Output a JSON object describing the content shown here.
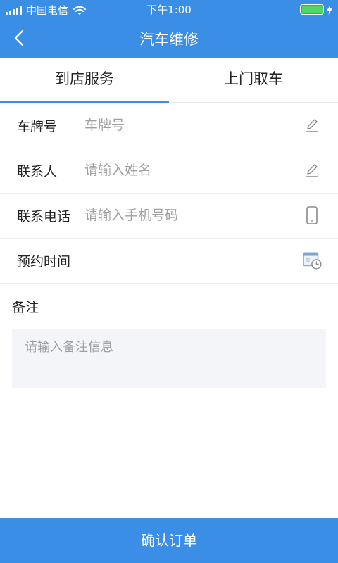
{
  "status_bar": {
    "carrier": "中国电信",
    "time": "下午1:00",
    "battery_level": 1.0,
    "icons": [
      "signal-icon",
      "wifi-icon",
      "battery-icon",
      "charging-icon"
    ]
  },
  "nav": {
    "title": "汽车维修",
    "back_icon": "chevron-left-icon"
  },
  "tabs": [
    {
      "label": "到店服务",
      "selected": true
    },
    {
      "label": "上门取车",
      "selected": false
    }
  ],
  "form": {
    "plate": {
      "label": "车牌号",
      "placeholder": "车牌号",
      "value": "",
      "icon": "edit-pencil-icon"
    },
    "contact": {
      "label": "联系人",
      "placeholder": "请输入姓名",
      "value": "",
      "icon": "edit-pencil-icon"
    },
    "phone": {
      "label": "联系电话",
      "placeholder": "请输入手机号码",
      "value": "",
      "icon": "phone-icon"
    },
    "appointment": {
      "label": "预约时间",
      "value": "",
      "icon": "calendar-clock-icon"
    }
  },
  "remark": {
    "label": "备注",
    "placeholder": "请输入备注信息",
    "value": ""
  },
  "confirm_label": "确认订单",
  "colors": {
    "primary": "#3a8ee6",
    "battery": "#4cd964",
    "placeholder": "#a0a0a0",
    "remark_bg": "#f3f5f9"
  }
}
